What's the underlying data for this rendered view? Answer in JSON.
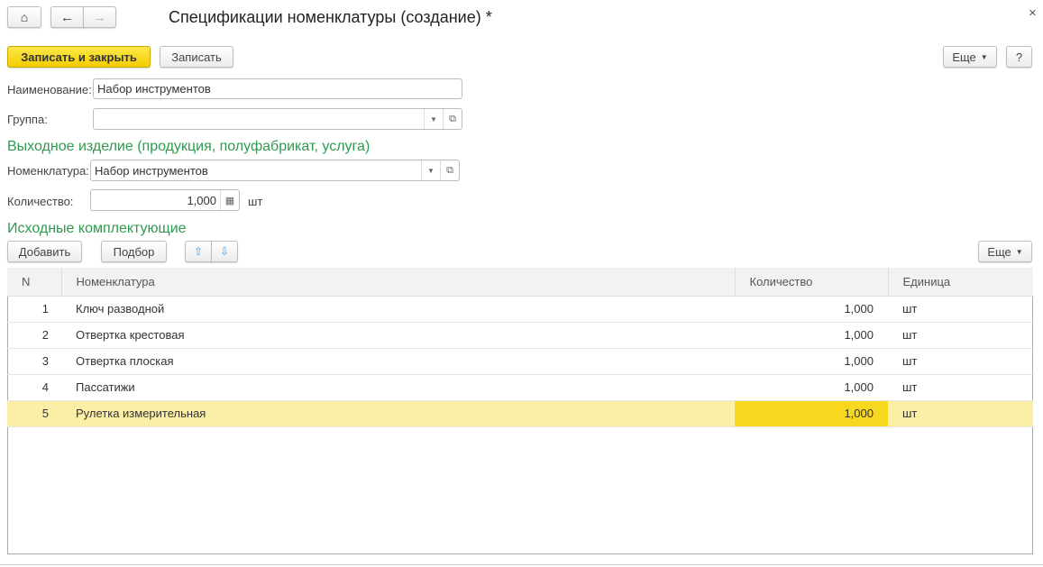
{
  "window": {
    "title": "Спецификации номенклатуры (создание) *",
    "close": "×"
  },
  "toolbar": {
    "save_close": "Записать и закрыть",
    "save": "Записать",
    "more": "Еще",
    "help": "?"
  },
  "form": {
    "name_label": "Наименование:",
    "name_value": "Набор инструментов",
    "group_label": "Группа:",
    "group_value": "",
    "output_heading": "Выходное изделие (продукция, полуфабрикат, услуга)",
    "item_label": "Номенклатура:",
    "item_value": "Набор инструментов",
    "qty_label": "Количество:",
    "qty_value": "1,000",
    "qty_unit": "шт",
    "components_heading": "Исходные комплектующие"
  },
  "table_toolbar": {
    "add": "Добавить",
    "pick": "Подбор",
    "more": "Еще"
  },
  "table": {
    "headers": [
      "N",
      "Номенклатура",
      "Количество",
      "Единица"
    ],
    "rows": [
      {
        "n": "1",
        "name": "Ключ разводной",
        "qty": "1,000",
        "unit": "шт"
      },
      {
        "n": "2",
        "name": "Отвертка крестовая",
        "qty": "1,000",
        "unit": "шт"
      },
      {
        "n": "3",
        "name": "Отвертка плоская",
        "qty": "1,000",
        "unit": "шт"
      },
      {
        "n": "4",
        "name": "Пассатижи",
        "qty": "1,000",
        "unit": "шт"
      },
      {
        "n": "5",
        "name": "Рулетка измерительная",
        "qty": "1,000",
        "unit": "шт"
      }
    ]
  }
}
